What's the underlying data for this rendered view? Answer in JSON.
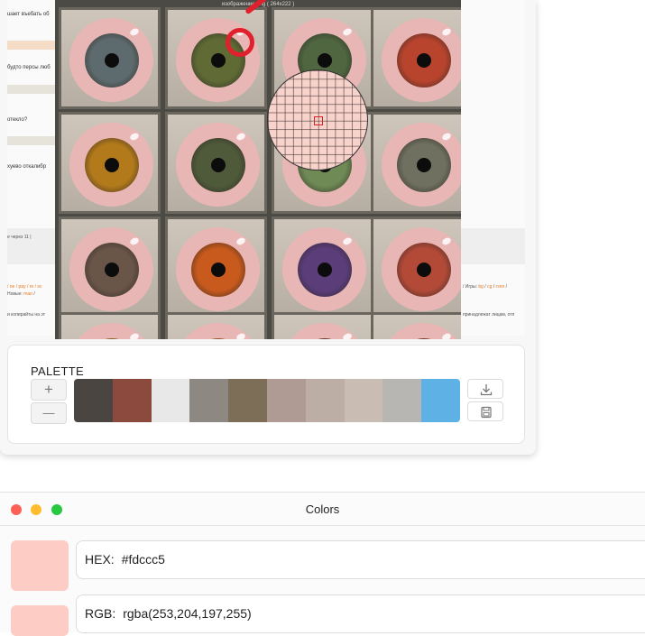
{
  "background_page": {
    "snippets": [
      "шает въебать об",
      "будто персы люб",
      "отекло?",
      "хуево откалибр",
      "е через 11 | ",
      "Игры:",
      "bg",
      "cg",
      "rsnn",
      "Новые:",
      "mao",
      "и копирайты на эт",
      "принадлежат лицам, отп"
    ]
  },
  "preview": {
    "title": "изображение.png ( 264x222 )",
    "iris_colors": [
      "#5e6b6e",
      "#5f6a35",
      "#4f6640",
      "#b8442e",
      "#b37a1c",
      "#4f5a3a",
      "#6f8a55",
      "#6f7060",
      "#6a5549",
      "#c85a1e",
      "#5b3d7a",
      "#b34a38",
      "#b07a22",
      "#c8662a",
      "#8a3a2e",
      "#9a3d2d"
    ]
  },
  "magnifier": {
    "color": "#f7d3cc"
  },
  "palette": {
    "title": "PALETTE",
    "add_label": "+",
    "remove_label": "—",
    "swatches": [
      "#4a4540",
      "#8b4a3d",
      "#e8e8e8",
      "#8e8882",
      "#7d6e58",
      "#b09a94",
      "#bcaea4",
      "#c9bdb3",
      "#b8b6b2",
      "#5db1e4"
    ]
  },
  "colors_window": {
    "title": "Colors",
    "preview_color": "#fdccc5",
    "hex_label": "HEX:",
    "hex_value": "#fdccc5",
    "rgb_label": "RGB:",
    "rgb_value": "rgba(253,204,197,255)",
    "traffic_lights": [
      "#fe5f57",
      "#febc2e",
      "#28c840"
    ]
  }
}
